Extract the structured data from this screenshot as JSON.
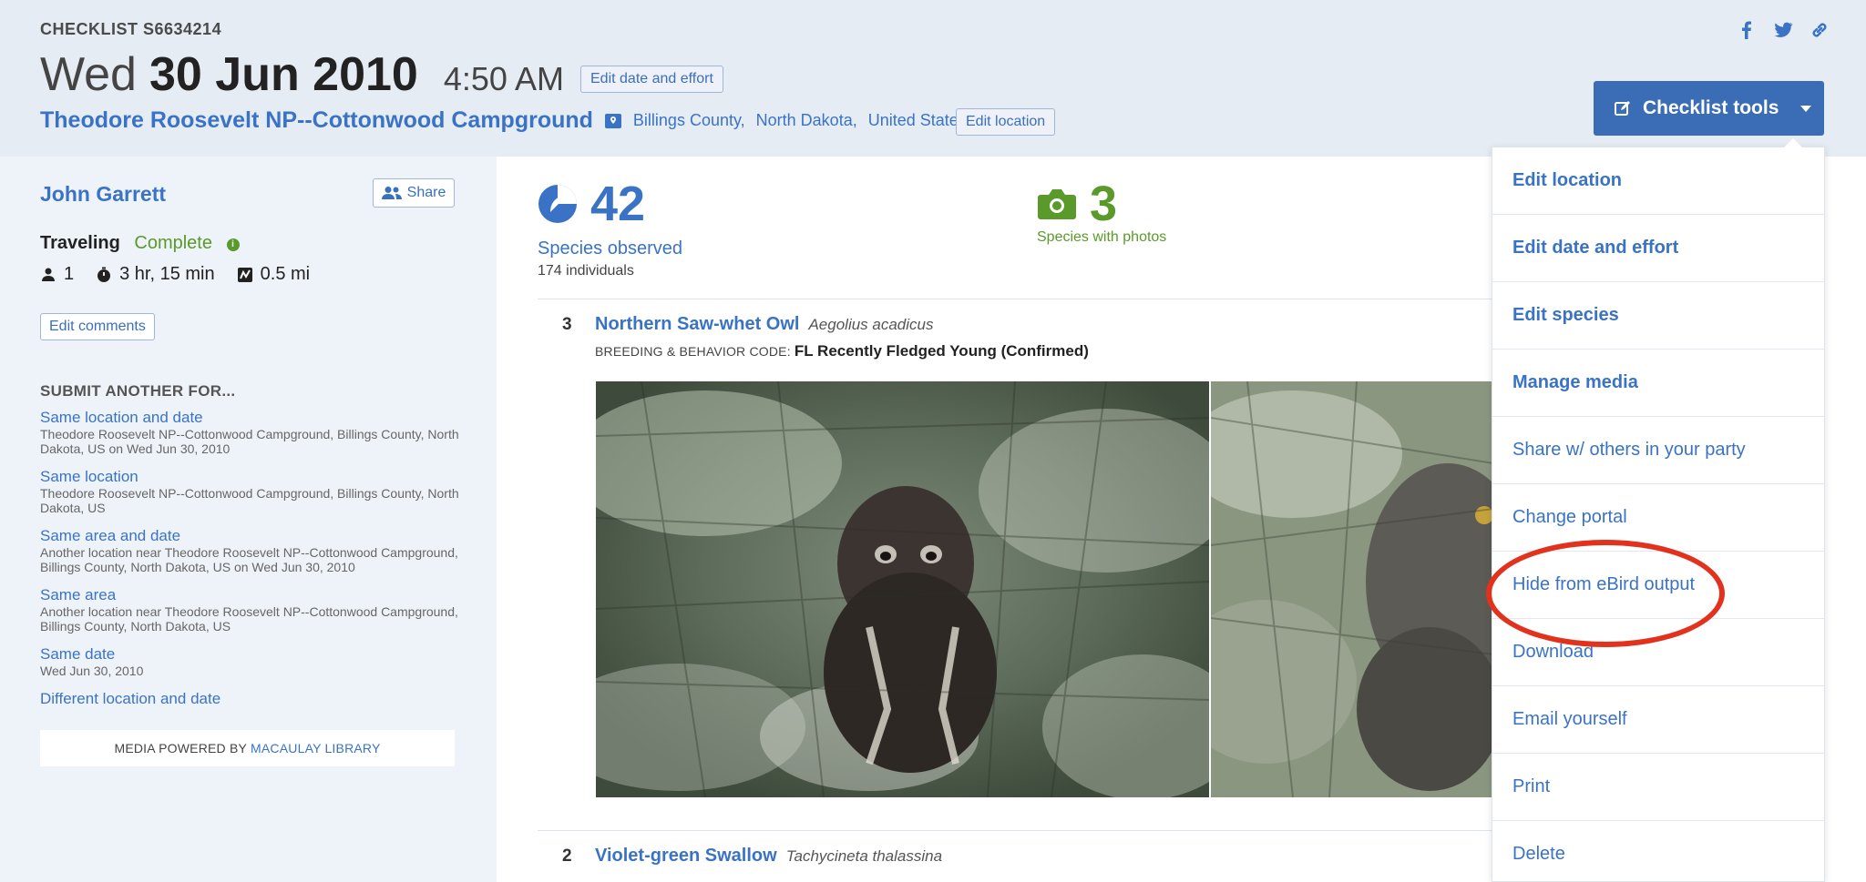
{
  "header": {
    "checklist_id": "CHECKLIST S6634214",
    "weekday": "Wed",
    "date": "30 Jun 2010",
    "time": "4:50 AM",
    "edit_date_label": "Edit date and effort",
    "location_name": "Theodore Roosevelt NP--Cottonwood Campground",
    "county": "Billings County,",
    "state": "North Dakota,",
    "country": "United States",
    "edit_location_label": "Edit location",
    "checklist_tools_label": "Checklist tools",
    "social_icons": [
      "facebook-icon",
      "twitter-icon",
      "link-icon"
    ]
  },
  "sidebar": {
    "observer": "John Garrett",
    "share_label": "Share",
    "protocol": "Traveling",
    "complete": "Complete",
    "party_size": "1",
    "duration": "3 hr, 15 min",
    "distance": "0.5 mi",
    "edit_comments_label": "Edit comments",
    "submit_heading": "SUBMIT ANOTHER FOR...",
    "submit_items": [
      {
        "label": "Same location and date",
        "desc": "Theodore Roosevelt NP--Cottonwood Campground, Billings County, North Dakota, US on Wed Jun 30, 2010"
      },
      {
        "label": "Same location",
        "desc": "Theodore Roosevelt NP--Cottonwood Campground, Billings County, North Dakota, US"
      },
      {
        "label": "Same area and date",
        "desc": "Another location near Theodore Roosevelt NP--Cottonwood Campground, Billings County, North Dakota, US on Wed Jun 30, 2010"
      },
      {
        "label": "Same area",
        "desc": "Another location near Theodore Roosevelt NP--Cottonwood Campground, Billings County, North Dakota, US"
      },
      {
        "label": "Same date",
        "desc": "Wed Jun 30, 2010"
      },
      {
        "label": "Different location and date",
        "desc": ""
      }
    ],
    "media_prefix": "MEDIA POWERED BY",
    "media_link": "MACAULAY LIBRARY"
  },
  "main": {
    "species_count": "42",
    "species_label": "Species observed",
    "individuals": "174 individuals",
    "photo_count": "3",
    "photo_label": "Species with photos",
    "species": [
      {
        "count": "3",
        "name": "Northern Saw-whet Owl",
        "sci": "Aegolius acadicus"
      },
      {
        "count": "2",
        "name": "Violet-green Swallow",
        "sci": "Tachycineta thalassina"
      }
    ],
    "breeding_label": "BREEDING & BEHAVIOR CODE:",
    "breeding_value": "FL Recently Fledged Young (Confirmed)"
  },
  "dropdown": {
    "items": [
      {
        "label": "Edit location"
      },
      {
        "label": "Edit date and effort"
      },
      {
        "label": "Edit species"
      },
      {
        "label": "Manage media"
      },
      {
        "label": "Share w/ others in your party"
      },
      {
        "label": "Change portal"
      },
      {
        "label": "Hide from eBird output"
      },
      {
        "label": "Download"
      },
      {
        "label": "Email yourself"
      },
      {
        "label": "Print"
      },
      {
        "label": "Delete"
      }
    ]
  },
  "colors": {
    "link": "#3a73c5",
    "green": "#5a9a2a",
    "tools_button": "#3a6db5",
    "highlight": "#e2311d"
  }
}
